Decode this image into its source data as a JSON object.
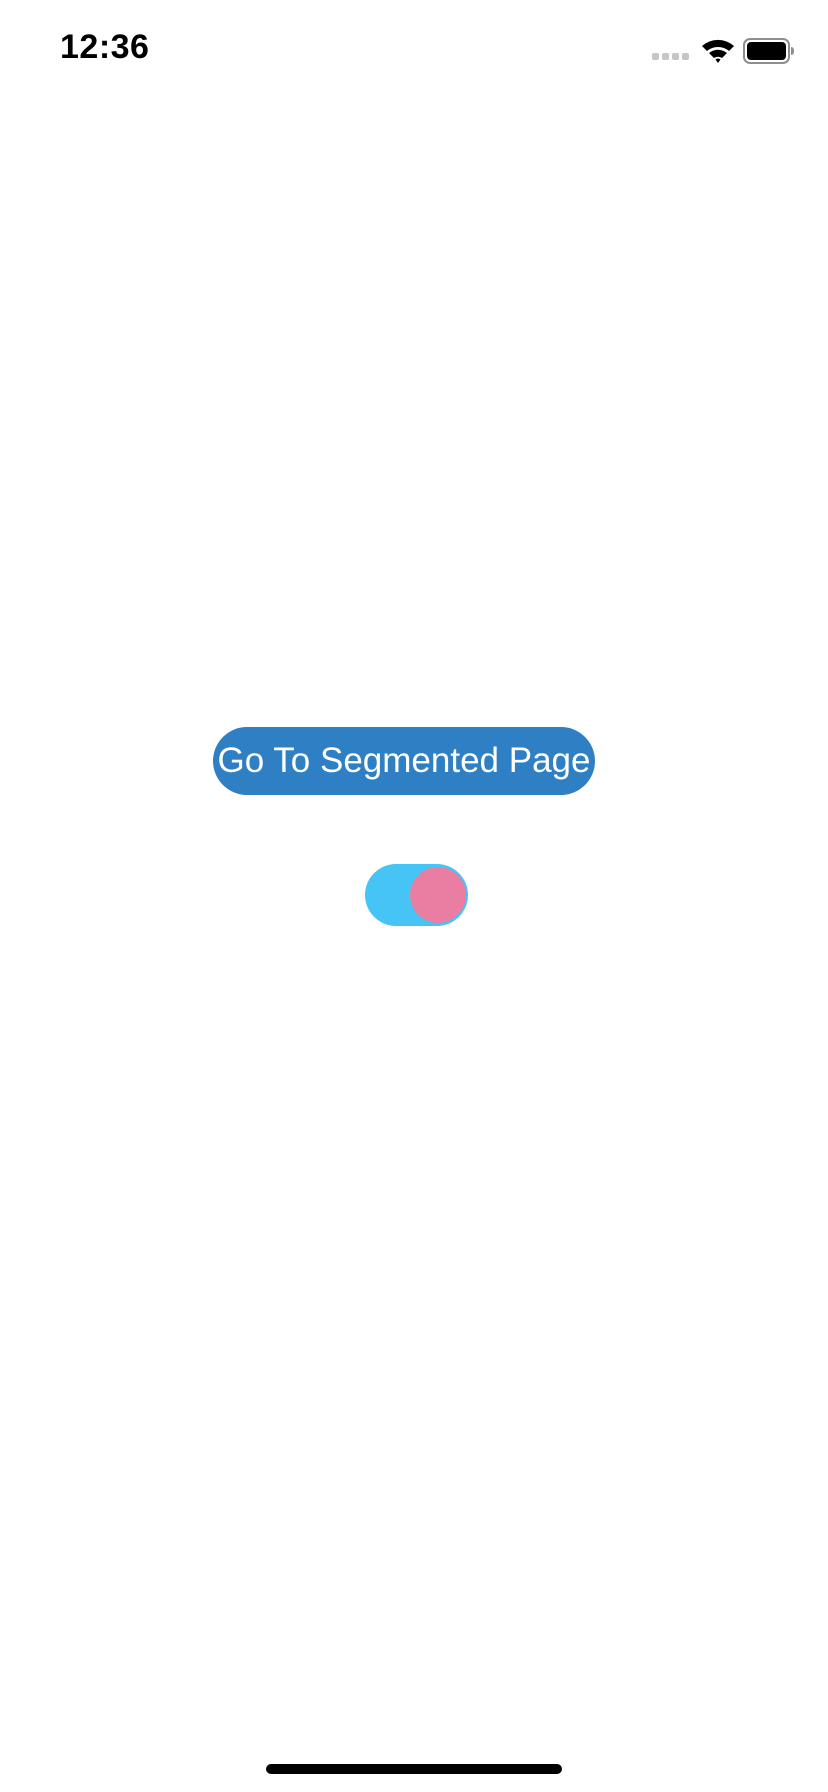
{
  "status_bar": {
    "time": "12:36",
    "icons": [
      "cellular-signal-icon",
      "wifi-icon",
      "battery-icon"
    ]
  },
  "main": {
    "segmented_button_label": "Go To Segmented Page",
    "toggle": {
      "state": "on"
    }
  },
  "colors": {
    "button_background": "#2f7fc4",
    "button_text": "#ffffff",
    "toggle_track": "#45c4f5",
    "toggle_knob": "#e97da2",
    "background": "#ffffff"
  }
}
